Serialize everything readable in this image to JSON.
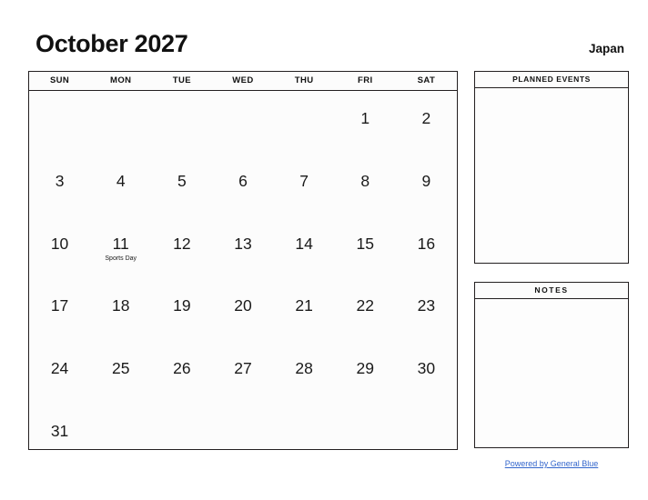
{
  "header": {
    "month_title": "October 2027",
    "country": "Japan"
  },
  "calendar": {
    "weekdays": [
      "SUN",
      "MON",
      "TUE",
      "WED",
      "THU",
      "FRI",
      "SAT"
    ],
    "weeks": [
      [
        {
          "day": "",
          "event": ""
        },
        {
          "day": "",
          "event": ""
        },
        {
          "day": "",
          "event": ""
        },
        {
          "day": "",
          "event": ""
        },
        {
          "day": "",
          "event": ""
        },
        {
          "day": "1",
          "event": ""
        },
        {
          "day": "2",
          "event": ""
        }
      ],
      [
        {
          "day": "3",
          "event": ""
        },
        {
          "day": "4",
          "event": ""
        },
        {
          "day": "5",
          "event": ""
        },
        {
          "day": "6",
          "event": ""
        },
        {
          "day": "7",
          "event": ""
        },
        {
          "day": "8",
          "event": ""
        },
        {
          "day": "9",
          "event": ""
        }
      ],
      [
        {
          "day": "10",
          "event": ""
        },
        {
          "day": "11",
          "event": "Sports Day"
        },
        {
          "day": "12",
          "event": ""
        },
        {
          "day": "13",
          "event": ""
        },
        {
          "day": "14",
          "event": ""
        },
        {
          "day": "15",
          "event": ""
        },
        {
          "day": "16",
          "event": ""
        }
      ],
      [
        {
          "day": "17",
          "event": ""
        },
        {
          "day": "18",
          "event": ""
        },
        {
          "day": "19",
          "event": ""
        },
        {
          "day": "20",
          "event": ""
        },
        {
          "day": "21",
          "event": ""
        },
        {
          "day": "22",
          "event": ""
        },
        {
          "day": "23",
          "event": ""
        }
      ],
      [
        {
          "day": "24",
          "event": ""
        },
        {
          "day": "25",
          "event": ""
        },
        {
          "day": "26",
          "event": ""
        },
        {
          "day": "27",
          "event": ""
        },
        {
          "day": "28",
          "event": ""
        },
        {
          "day": "29",
          "event": ""
        },
        {
          "day": "30",
          "event": ""
        }
      ],
      [
        {
          "day": "31",
          "event": ""
        },
        {
          "day": "",
          "event": ""
        },
        {
          "day": "",
          "event": ""
        },
        {
          "day": "",
          "event": ""
        },
        {
          "day": "",
          "event": ""
        },
        {
          "day": "",
          "event": ""
        },
        {
          "day": "",
          "event": ""
        }
      ]
    ]
  },
  "planned_events": {
    "title": "PLANNED EVENTS",
    "content": ""
  },
  "notes": {
    "title": "NOTES",
    "content": ""
  },
  "footer": {
    "link_text": "Powered by General Blue",
    "link_color": "#3366cc"
  }
}
